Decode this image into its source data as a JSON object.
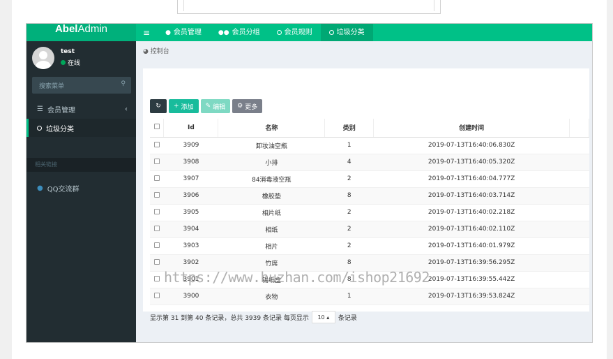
{
  "app": {
    "logo_bold": "Abel",
    "logo_rest": "Admin"
  },
  "header": {
    "toggle_icon": "≡",
    "nav": [
      {
        "label": "会员管理",
        "icon": "user-icon"
      },
      {
        "label": "会员分组",
        "icon": "users-icon"
      },
      {
        "label": "会员规则",
        "icon": "circle-icon"
      },
      {
        "label": "垃圾分类",
        "icon": "circle-icon",
        "active": true
      }
    ]
  },
  "sidebar": {
    "user": {
      "name": "test",
      "status": "在线",
      "status_color": "#00a65a"
    },
    "search": {
      "placeholder": "搜索菜单"
    },
    "items": [
      {
        "label": "会员管理",
        "icon": "list-icon"
      },
      {
        "label": "垃圾分类",
        "icon": "circle-icon",
        "active": true
      }
    ],
    "section_header": "相关链接",
    "links": [
      {
        "label": "QQ交流群",
        "icon": "qq-icon"
      }
    ]
  },
  "breadcrumb": {
    "label": "控制台",
    "icon": "dashboard-icon"
  },
  "toolbar": {
    "add_label": "添加",
    "edit_label": "编辑",
    "more_label": "更多"
  },
  "table": {
    "columns": [
      "Id",
      "名称",
      "类别",
      "创建时间"
    ],
    "rows": [
      {
        "id": "3909",
        "name": "卸妆油空瓶",
        "category": "1",
        "created": "2019-07-13T16:40:06.830Z"
      },
      {
        "id": "3908",
        "name": "小排",
        "category": "4",
        "created": "2019-07-13T16:40:05.320Z"
      },
      {
        "id": "3907",
        "name": "84消毒液空瓶",
        "category": "2",
        "created": "2019-07-13T16:40:04.777Z"
      },
      {
        "id": "3906",
        "name": "橡胶垫",
        "category": "8",
        "created": "2019-07-13T16:40:03.714Z"
      },
      {
        "id": "3905",
        "name": "相片纸",
        "category": "2",
        "created": "2019-07-13T16:40:02.218Z"
      },
      {
        "id": "3904",
        "name": "相纸",
        "category": "2",
        "created": "2019-07-13T16:40:02.110Z"
      },
      {
        "id": "3903",
        "name": "相片",
        "category": "2",
        "created": "2019-07-13T16:40:01.979Z"
      },
      {
        "id": "3902",
        "name": "竹席",
        "category": "8",
        "created": "2019-07-13T16:39:56.295Z"
      },
      {
        "id": "3901",
        "name": "锡纸盒",
        "category": "8",
        "created": "2019-07-13T16:39:55.442Z"
      },
      {
        "id": "3900",
        "name": "衣物",
        "category": "1",
        "created": "2019-07-13T16:39:53.824Z"
      }
    ]
  },
  "pagination": {
    "summary": "显示第 31 到第 40 条记录，总共 3939 条记录 每页显示",
    "page_size": "10",
    "suffix": "条记录"
  },
  "watermark": "https://www.huzhan.com/ishop21692",
  "colors": {
    "brand": "#00c187",
    "sidebar": "#222d32",
    "add": "#18bc9c"
  }
}
